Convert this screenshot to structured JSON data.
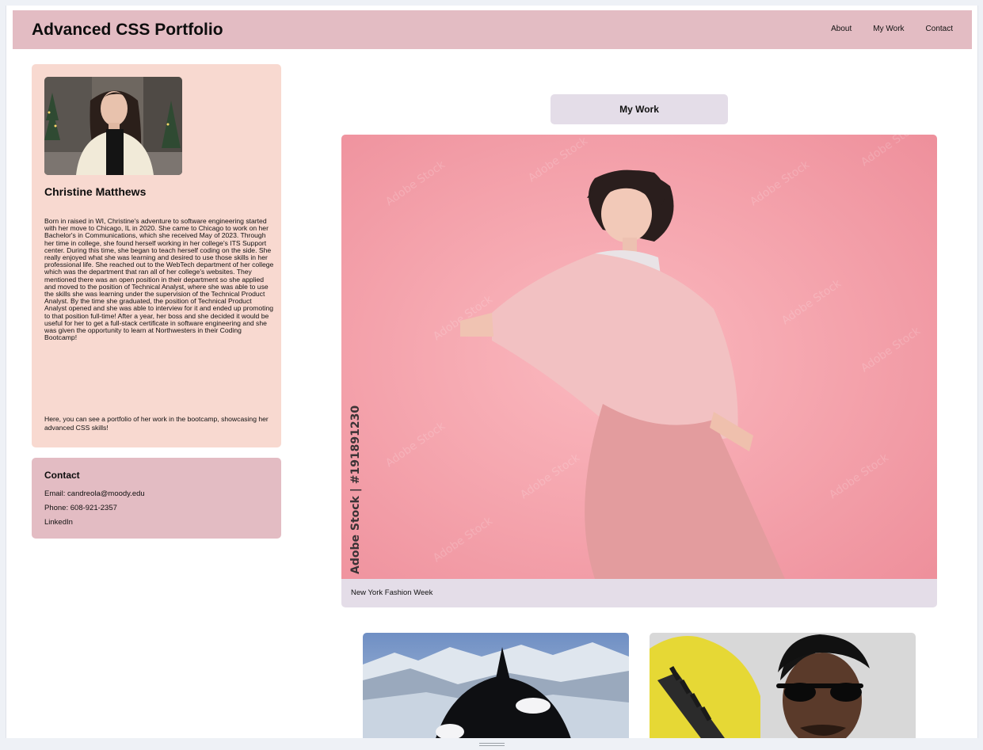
{
  "header": {
    "title": "Advanced CSS Portfolio",
    "nav": [
      "About",
      "My Work",
      "Contact"
    ]
  },
  "profile": {
    "name": "Christine Matthews",
    "bio": "Born in raised in WI, Christine's adventure to software engineering started with her move to Chicago, IL in 2020. She came to Chicago to work on her Bachelor's in Communications, which she received May of 2023. Through her time in college, she found herself working in her college's ITS Support center. During this time, she began to teach herself coding on the side. She really enjoyed what she was learning and desired to use those skills in her professional life. She reached out to the WebTech department of her college which was the department that ran all of her college's websites. They mentioned there was an open position in their department so she applied and moved to the position of Technical Analyst, where she was able to use the skills she was learning under the supervision of the Technical Product Analyst. By the time she graduated, the position of Technical Product Analyst opened and she was able to interview for it and ended up promoting to that position full-time! After a year, her boss and she decided it would be useful for her to get a full-stack certificate in software engineering and she was given the opportunity to learn at Northwesters in their Coding Bootcamp!",
    "bio_portfolio": "Here, you can see a portfolio of her work in the bootcamp, showcasing her advanced CSS skills!"
  },
  "contact": {
    "title": "Contact",
    "email": "Email: candreola@moody.edu",
    "phone": "Phone: 608-921-2357",
    "linkedin": "LinkedIn"
  },
  "work": {
    "heading": "My Work",
    "feature": {
      "caption": "New York Fashion Week",
      "stock_label": "Adobe Stock | #191891230",
      "watermark": "Adobe Stock"
    }
  },
  "colors": {
    "header_bg": "#e3bcc3",
    "profile_bg": "#f8d9d0",
    "contact_bg": "#e3bcc3",
    "work_bg": "#e4dde8",
    "feature_photo_bg": "#f5a9b1"
  },
  "icons": {
    "resize_handle": "grip-lines-icon"
  }
}
